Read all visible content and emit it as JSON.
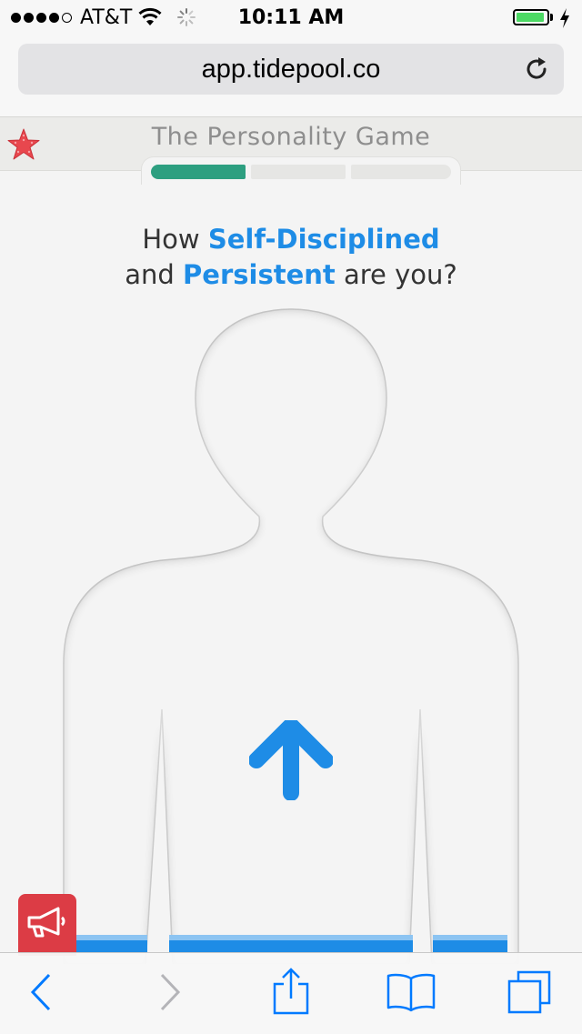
{
  "status_bar": {
    "carrier": "AT&T",
    "time": "10:11 AM",
    "signal_bars_filled": 4,
    "signal_bars_total": 5,
    "battery_level": 0.95,
    "icons": [
      "wifi-icon",
      "activity-spinner-icon",
      "battery-icon",
      "charging-bolt-icon"
    ]
  },
  "browser": {
    "url": "app.tidepool.co",
    "reload_icon": "reload-icon"
  },
  "game": {
    "title": "The Personality Game",
    "logo_icon": "starfish-icon",
    "progress": {
      "steps_total": 3,
      "steps_completed": 1
    },
    "question": {
      "prefix": "How ",
      "trait1": "Self-Disciplined",
      "middle": "and ",
      "trait2": "Persistent",
      "suffix": " are you?"
    },
    "figure_icon": "person-silhouette",
    "arrow_icon": "up-arrow-icon",
    "feedback_icon": "megaphone-icon"
  },
  "toolbar": {
    "items": [
      "back-icon",
      "forward-icon",
      "share-icon",
      "bookmarks-icon",
      "tabs-icon"
    ]
  },
  "colors": {
    "accent_blue": "#1e8ce6",
    "progress_green": "#2d9f80",
    "feedback_red": "#dc3c45",
    "ios_blue": "#007aff"
  }
}
